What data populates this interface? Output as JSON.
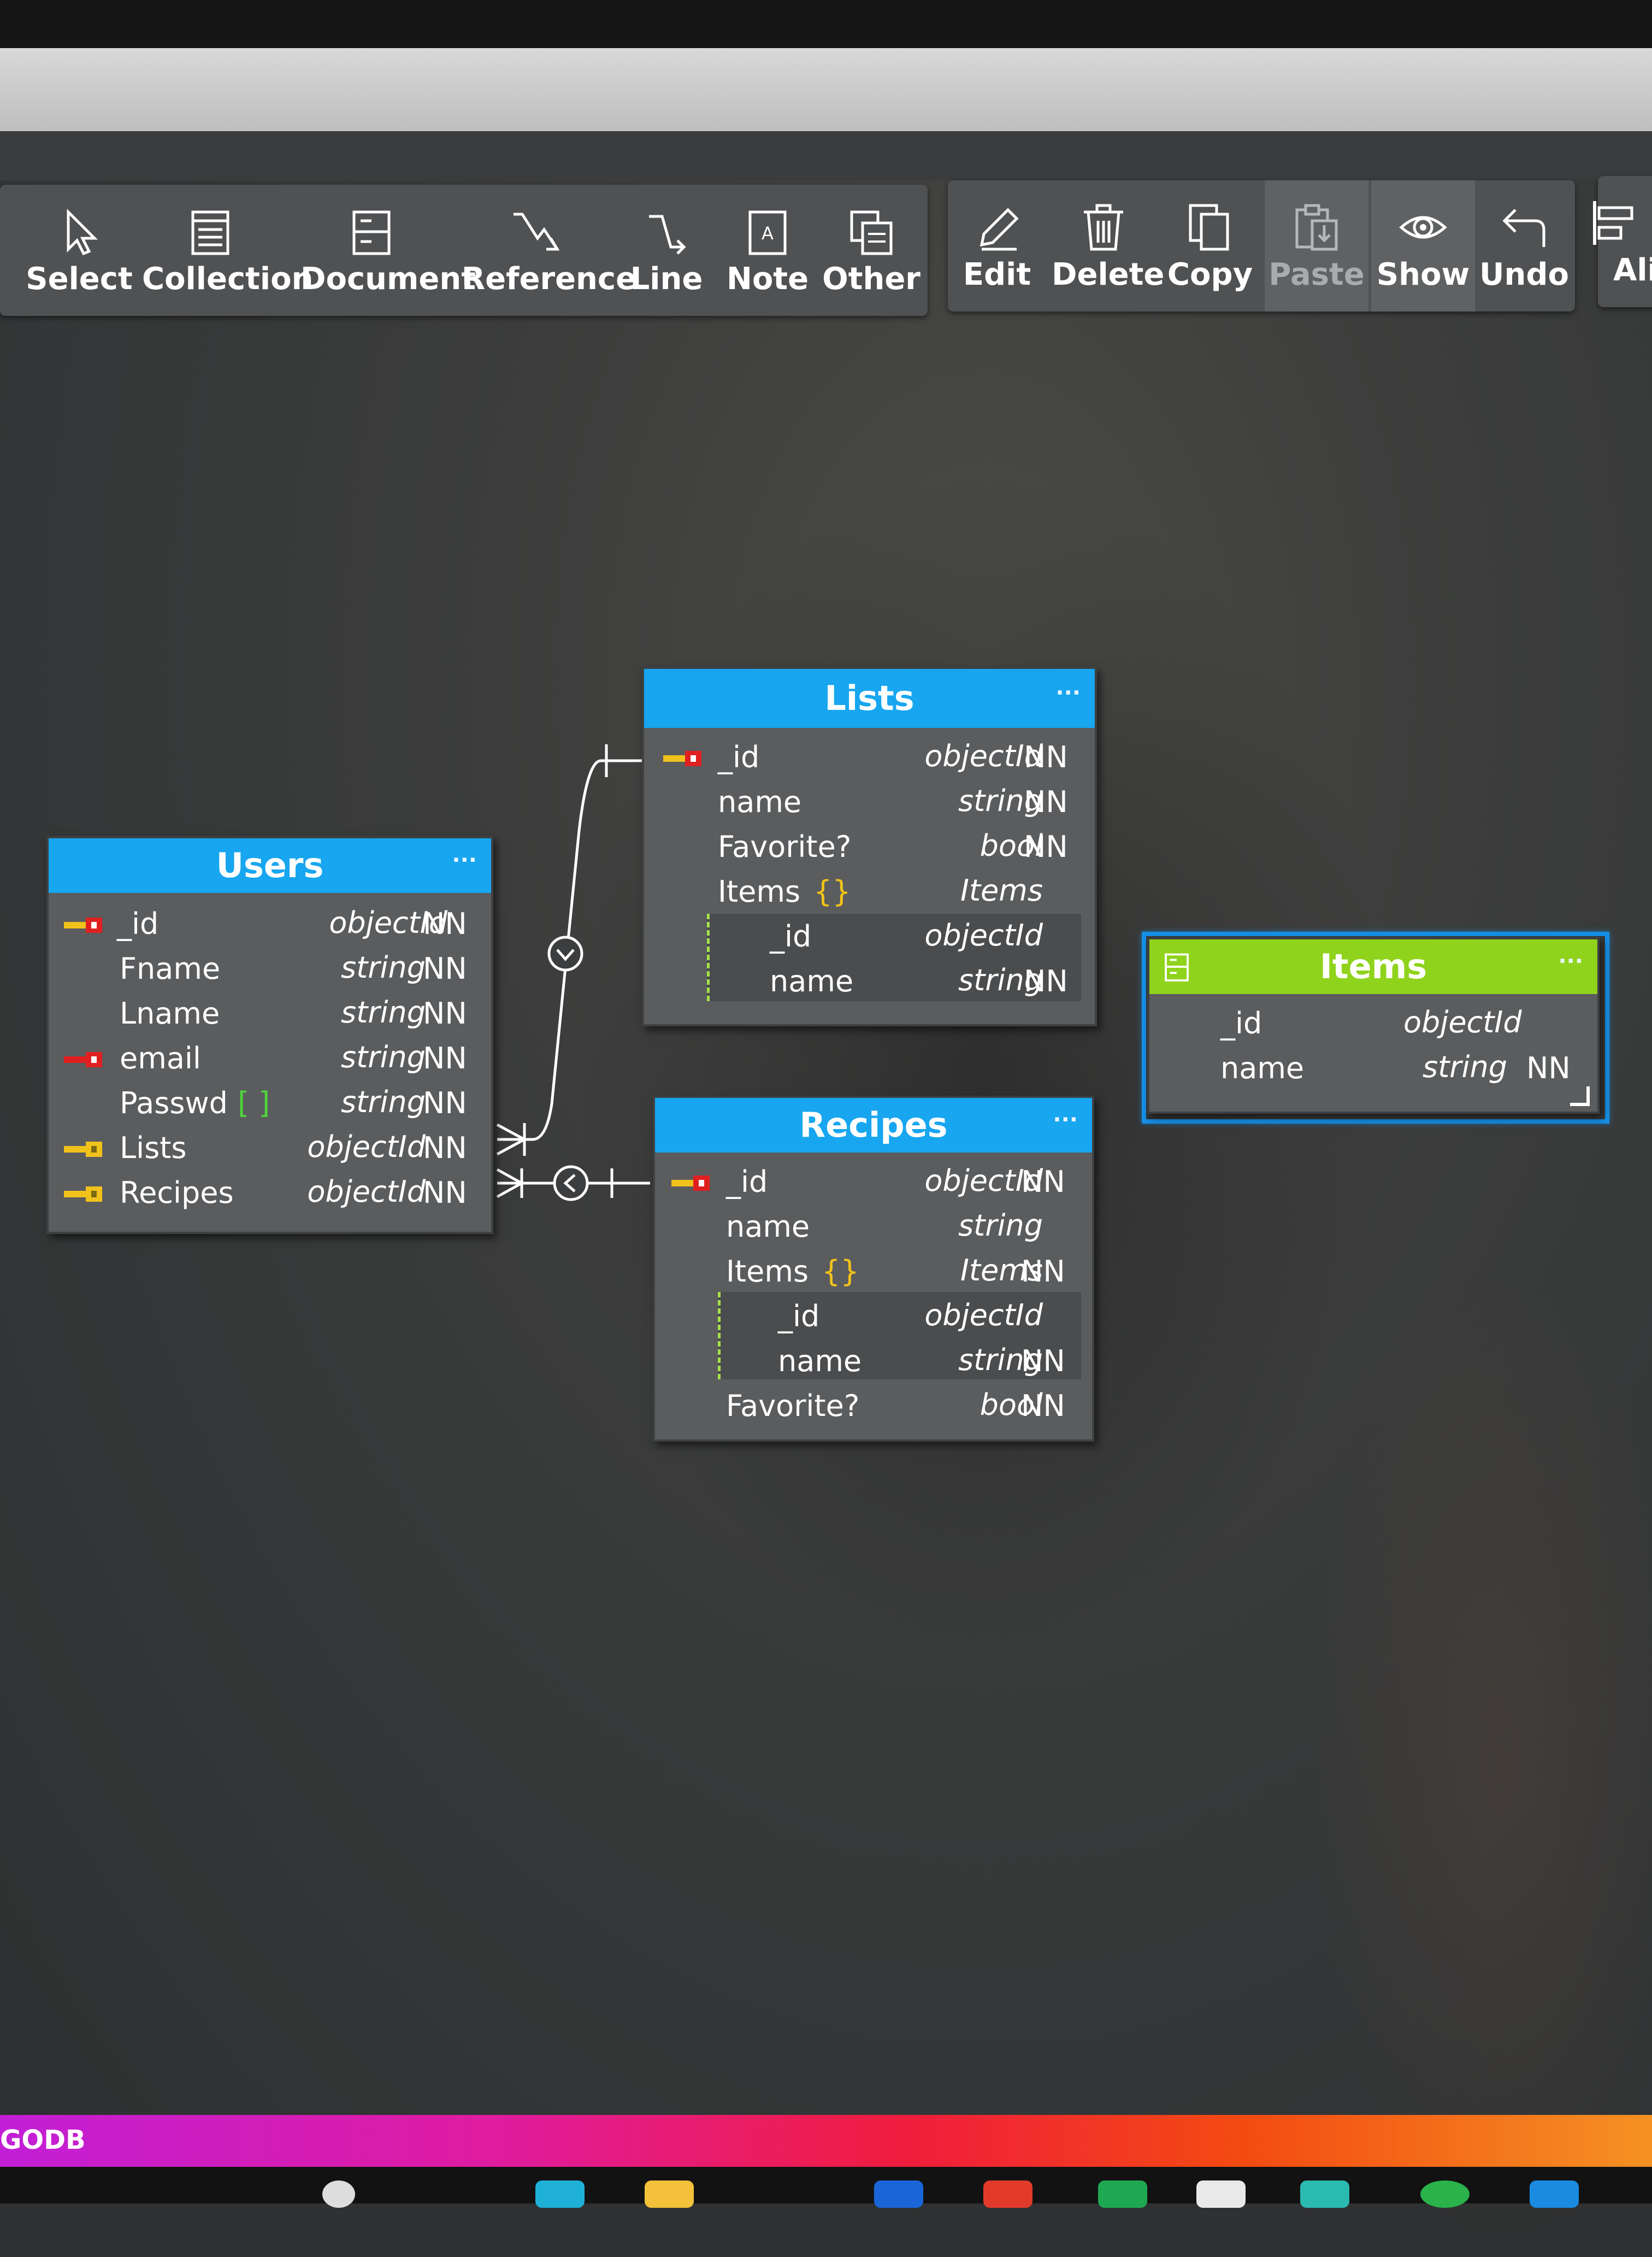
{
  "toolbar": {
    "group1": [
      {
        "label": "Select",
        "icon": "pointer-icon"
      },
      {
        "label": "Collection",
        "icon": "collection-icon"
      },
      {
        "label": "Document",
        "icon": "document-icon"
      },
      {
        "label": "Reference",
        "icon": "reference-icon"
      },
      {
        "label": "Line",
        "icon": "line-icon"
      },
      {
        "label": "Note",
        "icon": "note-icon"
      },
      {
        "label": "Other",
        "icon": "other-icon"
      }
    ],
    "group2": [
      {
        "label": "Edit",
        "icon": "pencil-icon"
      },
      {
        "label": "Delete",
        "icon": "trash-icon"
      },
      {
        "label": "Copy",
        "icon": "copy-icon"
      },
      {
        "label": "Paste",
        "icon": "paste-icon",
        "disabled": true
      },
      {
        "label": "Show",
        "icon": "eye-icon"
      },
      {
        "label": "Undo",
        "icon": "undo-icon"
      }
    ],
    "group3": [
      {
        "label": "Ali",
        "icon": "align-icon"
      }
    ]
  },
  "entities": {
    "users": {
      "title": "Users",
      "rows": [
        {
          "name": "_id",
          "type": "objectId",
          "nn": "NN"
        },
        {
          "name": "Fname",
          "type": "string",
          "nn": "NN"
        },
        {
          "name": "Lname",
          "type": "string",
          "nn": "NN"
        },
        {
          "name": "email",
          "type": "string",
          "nn": "NN"
        },
        {
          "name": "Passwd",
          "suffix": "[ ]",
          "type": "string",
          "nn": "NN"
        },
        {
          "name": "Lists",
          "type": "objectId",
          "nn": "NN"
        },
        {
          "name": "Recipes",
          "type": "objectId",
          "nn": "NN"
        }
      ]
    },
    "lists": {
      "title": "Lists",
      "rows": [
        {
          "name": "_id",
          "type": "objectId",
          "nn": "NN"
        },
        {
          "name": "name",
          "type": "string",
          "nn": "NN"
        },
        {
          "name": "Favorite?",
          "type": "bool",
          "nn": "NN"
        },
        {
          "name": "Items",
          "suffix": "{}",
          "type": "Items",
          "nn": ""
        },
        {
          "name": "_id",
          "type": "objectId",
          "nn": ""
        },
        {
          "name": "name",
          "type": "string",
          "nn": "NN"
        }
      ]
    },
    "recipes": {
      "title": "Recipes",
      "rows": [
        {
          "name": "_id",
          "type": "objectId",
          "nn": "NN"
        },
        {
          "name": "name",
          "type": "string",
          "nn": ""
        },
        {
          "name": "Items",
          "suffix": "{}",
          "type": "Items",
          "nn": "NN"
        },
        {
          "name": "_id",
          "type": "objectId",
          "nn": ""
        },
        {
          "name": "name",
          "type": "string",
          "nn": "NN"
        },
        {
          "name": "Favorite?",
          "type": "bool",
          "nn": "NN"
        }
      ]
    },
    "items": {
      "title": "Items",
      "rows": [
        {
          "name": "_id",
          "type": "objectId",
          "nn": ""
        },
        {
          "name": "name",
          "type": "string",
          "nn": "NN"
        }
      ]
    }
  },
  "more_label": "···",
  "taskbar": {
    "text": "GODB"
  },
  "colors": {
    "header_blue": "#17a6ef",
    "header_green": "#8fd31c",
    "selection": "#1590e8",
    "key_red": "#e02020",
    "key_yellow": "#f1c21b"
  }
}
